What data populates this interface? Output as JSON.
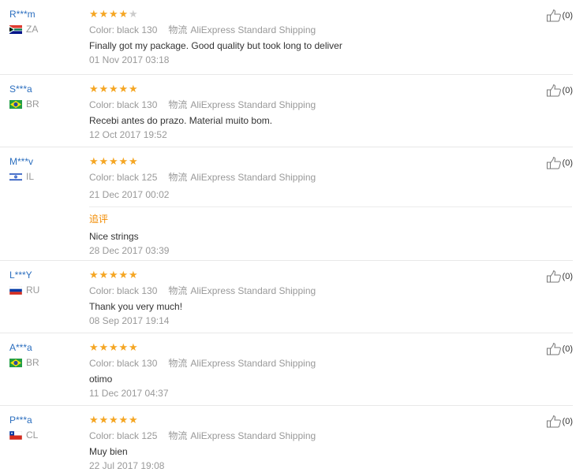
{
  "reviews": [
    {
      "user": "R***m",
      "country": "ZA",
      "rating": 4,
      "color_label": "Color:",
      "color_value": "black 130",
      "shipping_label": "物流",
      "shipping_value": "AliExpress Standard Shipping",
      "text": "Finally got my package. Good quality but took long to deliver",
      "date": "01 Nov 2017 03:18",
      "likes": "(0)"
    },
    {
      "user": "S***a",
      "country": "BR",
      "rating": 5,
      "color_label": "Color:",
      "color_value": "black 130",
      "shipping_label": "物流",
      "shipping_value": "AliExpress Standard Shipping",
      "text": "Recebi antes do prazo. Material muito bom.",
      "date": "12 Oct 2017 19:52",
      "likes": "(0)"
    },
    {
      "user": "M***v",
      "country": "IL",
      "rating": 5,
      "color_label": "Color:",
      "color_value": "black 125",
      "shipping_label": "物流",
      "shipping_value": "AliExpress Standard Shipping",
      "text": "",
      "date": "21 Dec 2017 00:02",
      "followup_label": "追评",
      "followup_text": "Nice strings",
      "followup_date": "28 Dec 2017 03:39",
      "likes": "(0)"
    },
    {
      "user": "L***Y",
      "country": "RU",
      "rating": 5,
      "color_label": "Color:",
      "color_value": "black 130",
      "shipping_label": "物流",
      "shipping_value": "AliExpress Standard Shipping",
      "text": "Thank you very much!",
      "date": "08 Sep 2017 19:14",
      "likes": "(0)"
    },
    {
      "user": "A***a",
      "country": "BR",
      "rating": 5,
      "color_label": "Color:",
      "color_value": "black 130",
      "shipping_label": "物流",
      "shipping_value": "AliExpress Standard Shipping",
      "text": "otimo",
      "date": "11 Dec 2017 04:37",
      "likes": "(0)"
    },
    {
      "user": "P***a",
      "country": "CL",
      "rating": 5,
      "color_label": "Color:",
      "color_value": "black 125",
      "shipping_label": "物流",
      "shipping_value": "AliExpress Standard Shipping",
      "text": "Muy bien",
      "date": "22 Jul 2017 19:08",
      "likes": "(0)"
    }
  ],
  "colors": {
    "username": "#2c6fbf",
    "star": "#f5a623",
    "followup": "#f28b00",
    "muted": "#999999"
  },
  "icons": {
    "like": "thumbs-up-icon",
    "star": "star-icon"
  }
}
